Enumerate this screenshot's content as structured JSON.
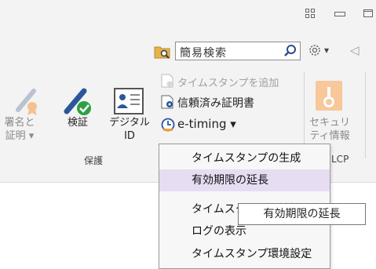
{
  "window": {
    "restore_glyph": "⊡",
    "minimize_glyph": "▭",
    "maximize_glyph": "▭"
  },
  "toolbar": {
    "search_placeholder": "簡易検索",
    "settings_glyph": "⚙",
    "dropdown_glyph": "▾",
    "collapse_glyph": "◁"
  },
  "ribbon": {
    "sign_certify": {
      "line1": "署名と",
      "line2": "証明 ▾"
    },
    "verify": {
      "label": "検証"
    },
    "digital_id": {
      "line1": "デジタル",
      "line2": "ID"
    },
    "add_timestamp": {
      "label": "タイムスタンプを追加"
    },
    "trusted_certs": {
      "label": "信頼済み証明書"
    },
    "etiming": {
      "label": "e-timing ▾"
    },
    "security_info": {
      "line1": "セキュリ",
      "line2": "ティ情報"
    },
    "group_protect": {
      "label": "保護"
    },
    "group_lcp": {
      "label": "LCP"
    }
  },
  "menu": {
    "items": [
      {
        "label": "タイムスタンプの生成"
      },
      {
        "label": "有効期限の延長"
      },
      {
        "label": "タイムスタンプの検証"
      },
      {
        "label": "ログの表示"
      },
      {
        "label": "タイムスタンプ環境設定"
      }
    ]
  },
  "tooltip": {
    "text": "有効期限の延長"
  },
  "colors": {
    "ribbon_bg": "#f3f3f3",
    "menu_highlight": "#e6ddf3",
    "accent_blue": "#2b579a",
    "verify_green": "#2ea043",
    "security_orange": "#f5a35c"
  }
}
